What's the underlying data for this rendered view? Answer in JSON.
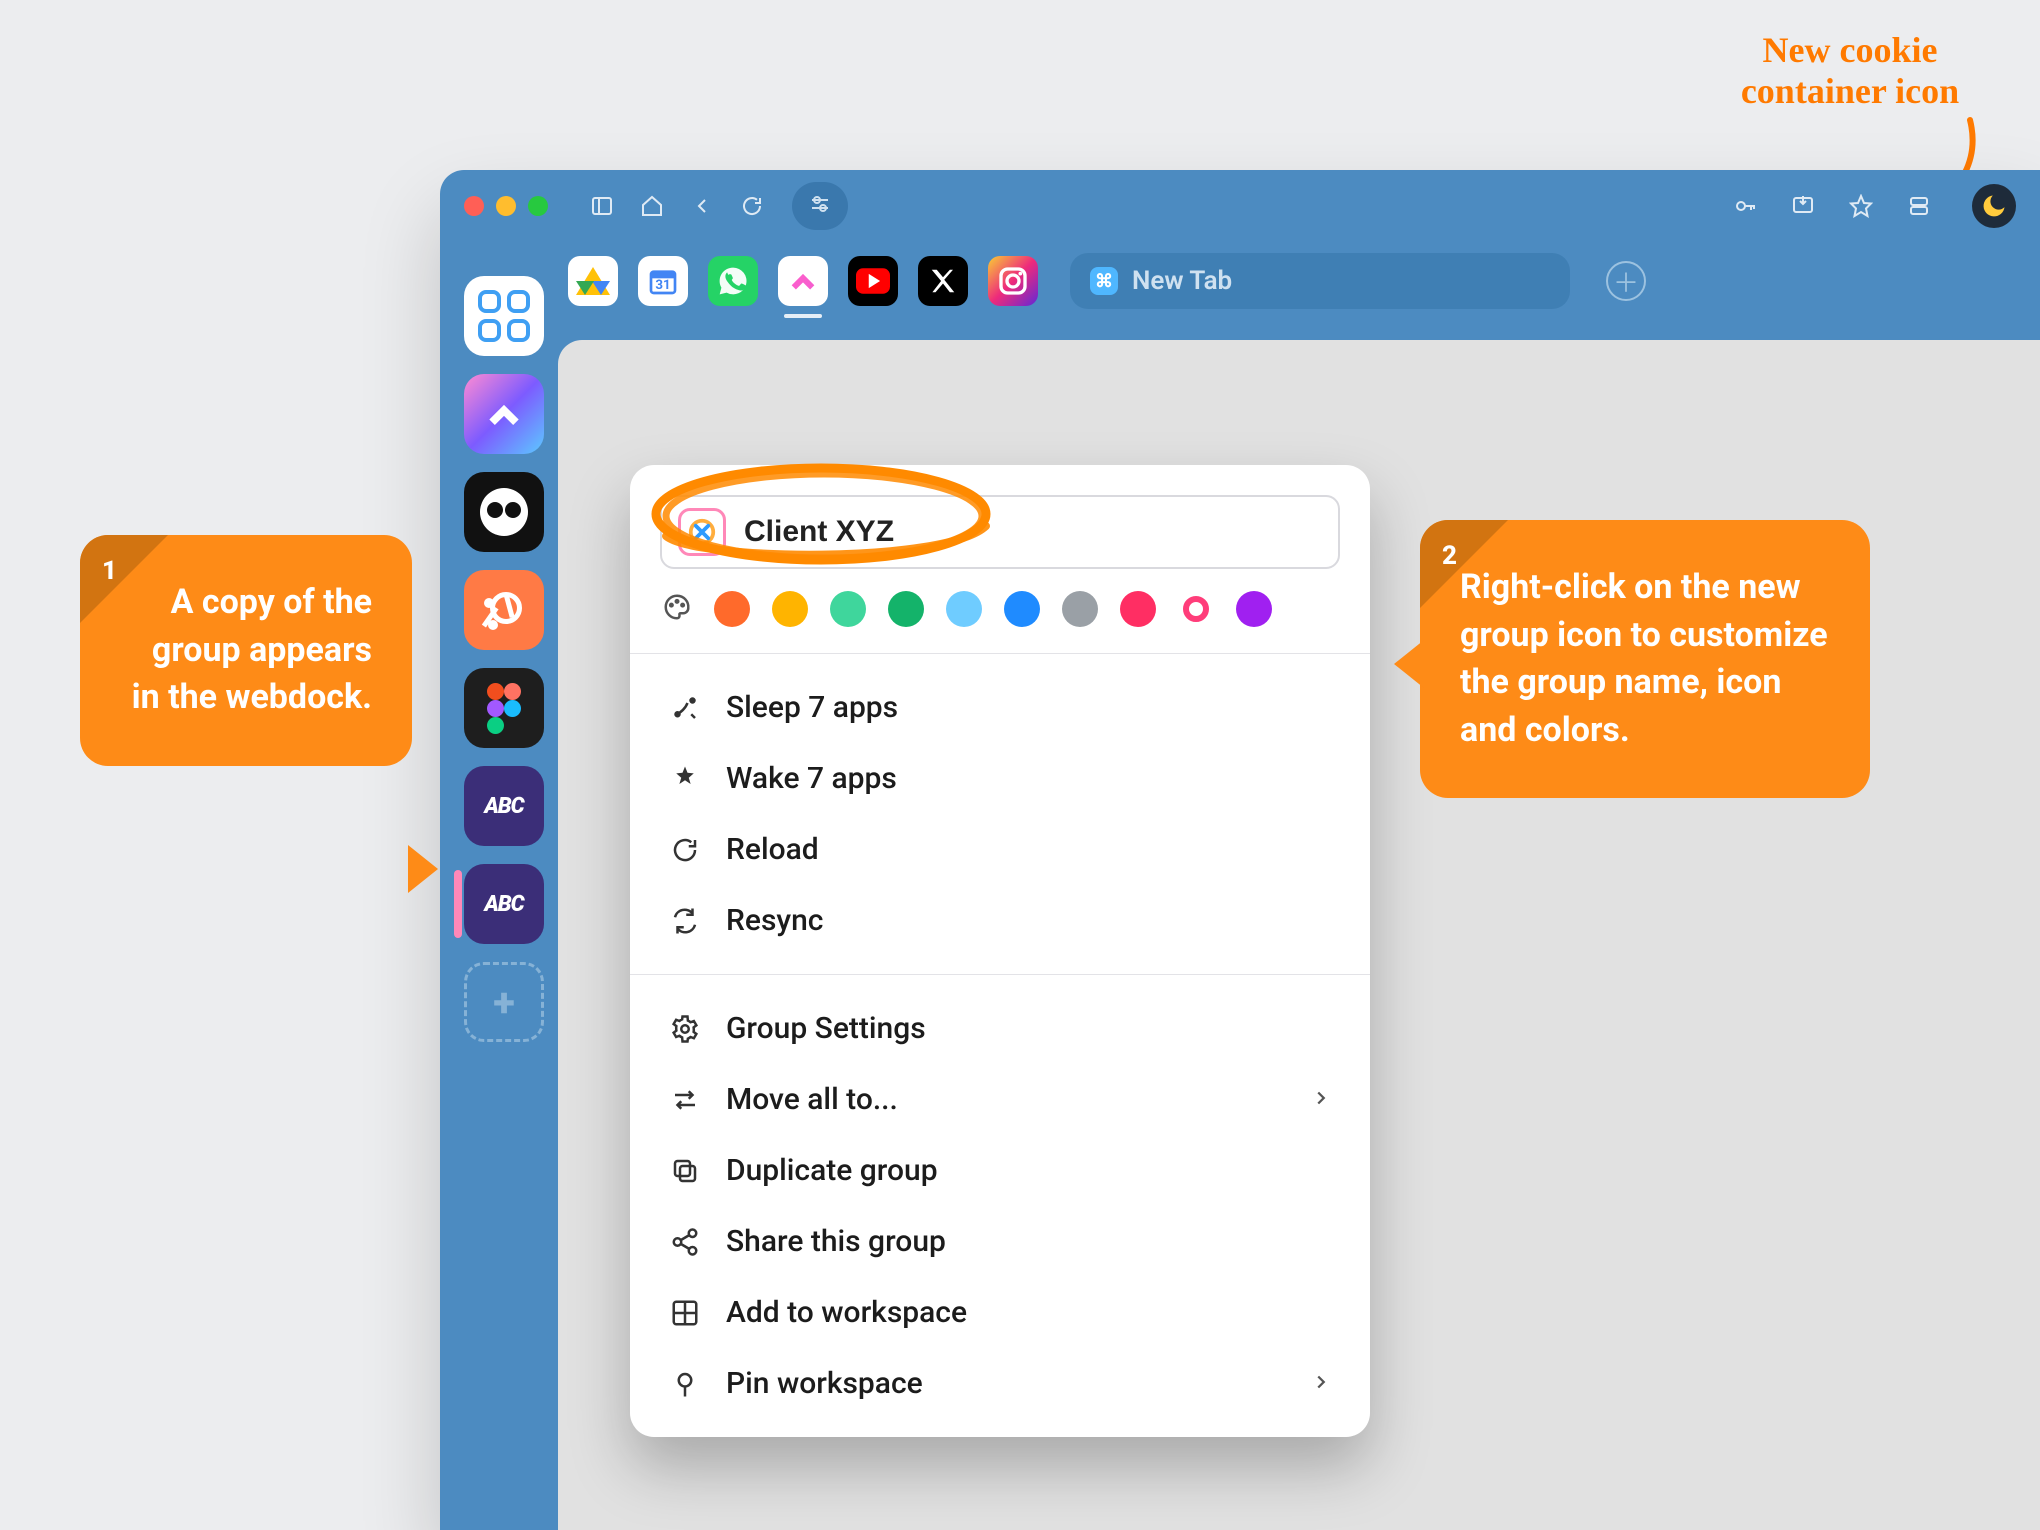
{
  "annotation_top": "New cookie container icon",
  "callout1": {
    "num": "1",
    "text": "A copy of the group appears in the webdock."
  },
  "callout2": {
    "num": "2",
    "text": "Right-click on the new group icon to customize the group name, icon and colors."
  },
  "tabstrip": {
    "new_tab_label": "New Tab"
  },
  "webdock": {
    "abc_label": "ABC"
  },
  "context_menu": {
    "group_name": "Client XYZ",
    "colors": [
      "#ff6a2b",
      "#ffb400",
      "#3fd69c",
      "#14b36a",
      "#6fccff",
      "#1f8bff",
      "#9aa0a6",
      "#ff2e63",
      "#ff3d7a",
      "#a020f0"
    ],
    "section1": {
      "sleep": "Sleep 7 apps",
      "wake": "Wake 7 apps",
      "reload": "Reload",
      "resync": "Resync"
    },
    "section2": {
      "settings": "Group Settings",
      "move": "Move all to...",
      "duplicate": "Duplicate group",
      "share": "Share this group",
      "add_workspace": "Add to workspace",
      "pin_workspace": "Pin workspace"
    }
  }
}
